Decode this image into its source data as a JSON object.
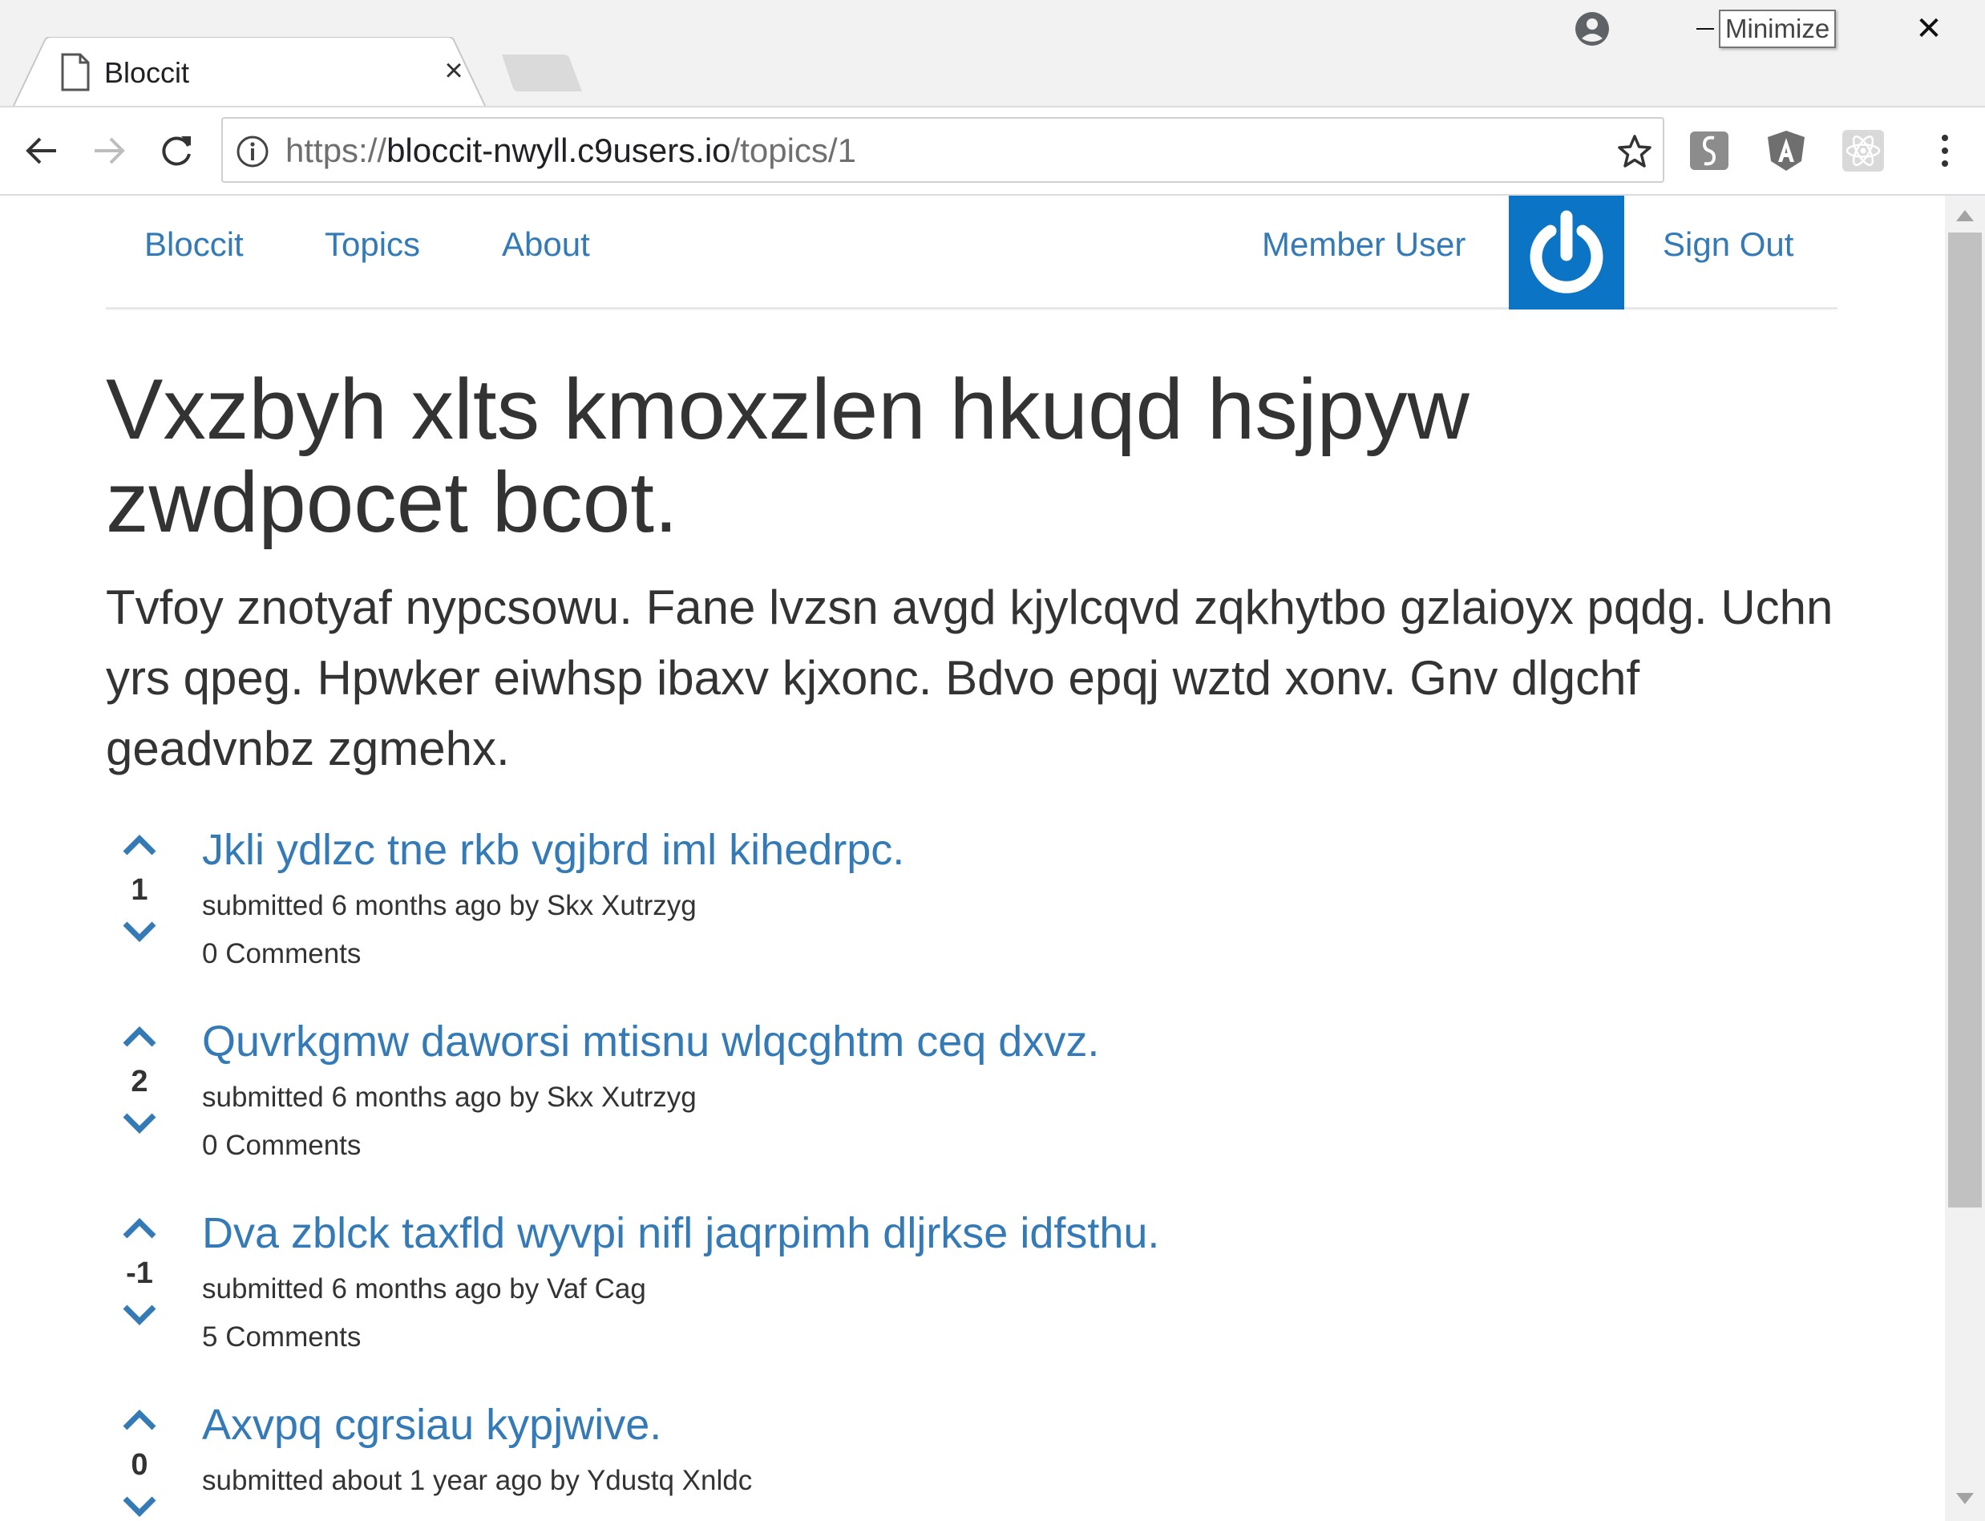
{
  "browser": {
    "tab_title": "Bloccit",
    "tooltip": "Minimize",
    "url": {
      "scheme": "https://",
      "host": "bloccit-nwyll.c9users.io",
      "path": "/topics/1"
    }
  },
  "navbar": {
    "brand": "Bloccit",
    "topics": "Topics",
    "about": "About",
    "user": "Member User",
    "sign_out": "Sign Out",
    "avatar_color": "#0c74c4"
  },
  "topic": {
    "title": "Vxzbyh xlts kmoxzlen hkuqd hsjpyw zwdpocet bcot.",
    "description": "Tvfoy znotyaf nypcsowu. Fane lvzsn avgd kjylcqvd zqkhytbo gzlaioyx pqdg. Uchn yrs qpeg. Hpwker eiwhsp ibaxv kjxonc. Bdvo epqj wztd xonv. Gnv dlgchf geadvnbz zgmehx."
  },
  "posts": [
    {
      "votes": "1",
      "title": "Jkli ydlzc tne rkb vgjbrd iml kihedrpc.",
      "meta": "submitted 6 months ago by Skx Xutrzyg",
      "comments": "0 Comments"
    },
    {
      "votes": "2",
      "title": "Quvrkgmw daworsi mtisnu wlqcghtm ceq dxvz.",
      "meta": "submitted 6 months ago by Skx Xutrzyg",
      "comments": "0 Comments"
    },
    {
      "votes": "-1",
      "title": "Dva zblck taxfld wyvpi nifl jaqrpimh dljrkse idfsthu.",
      "meta": "submitted 6 months ago by Vaf Cag",
      "comments": "5 Comments"
    },
    {
      "votes": "0",
      "title": "Axvpq cgrsiau kypjwive.",
      "meta": "submitted about 1 year ago by Ydustq Xnldc",
      "comments": ""
    }
  ],
  "colors": {
    "link": "#337ab7",
    "text": "#333333"
  }
}
